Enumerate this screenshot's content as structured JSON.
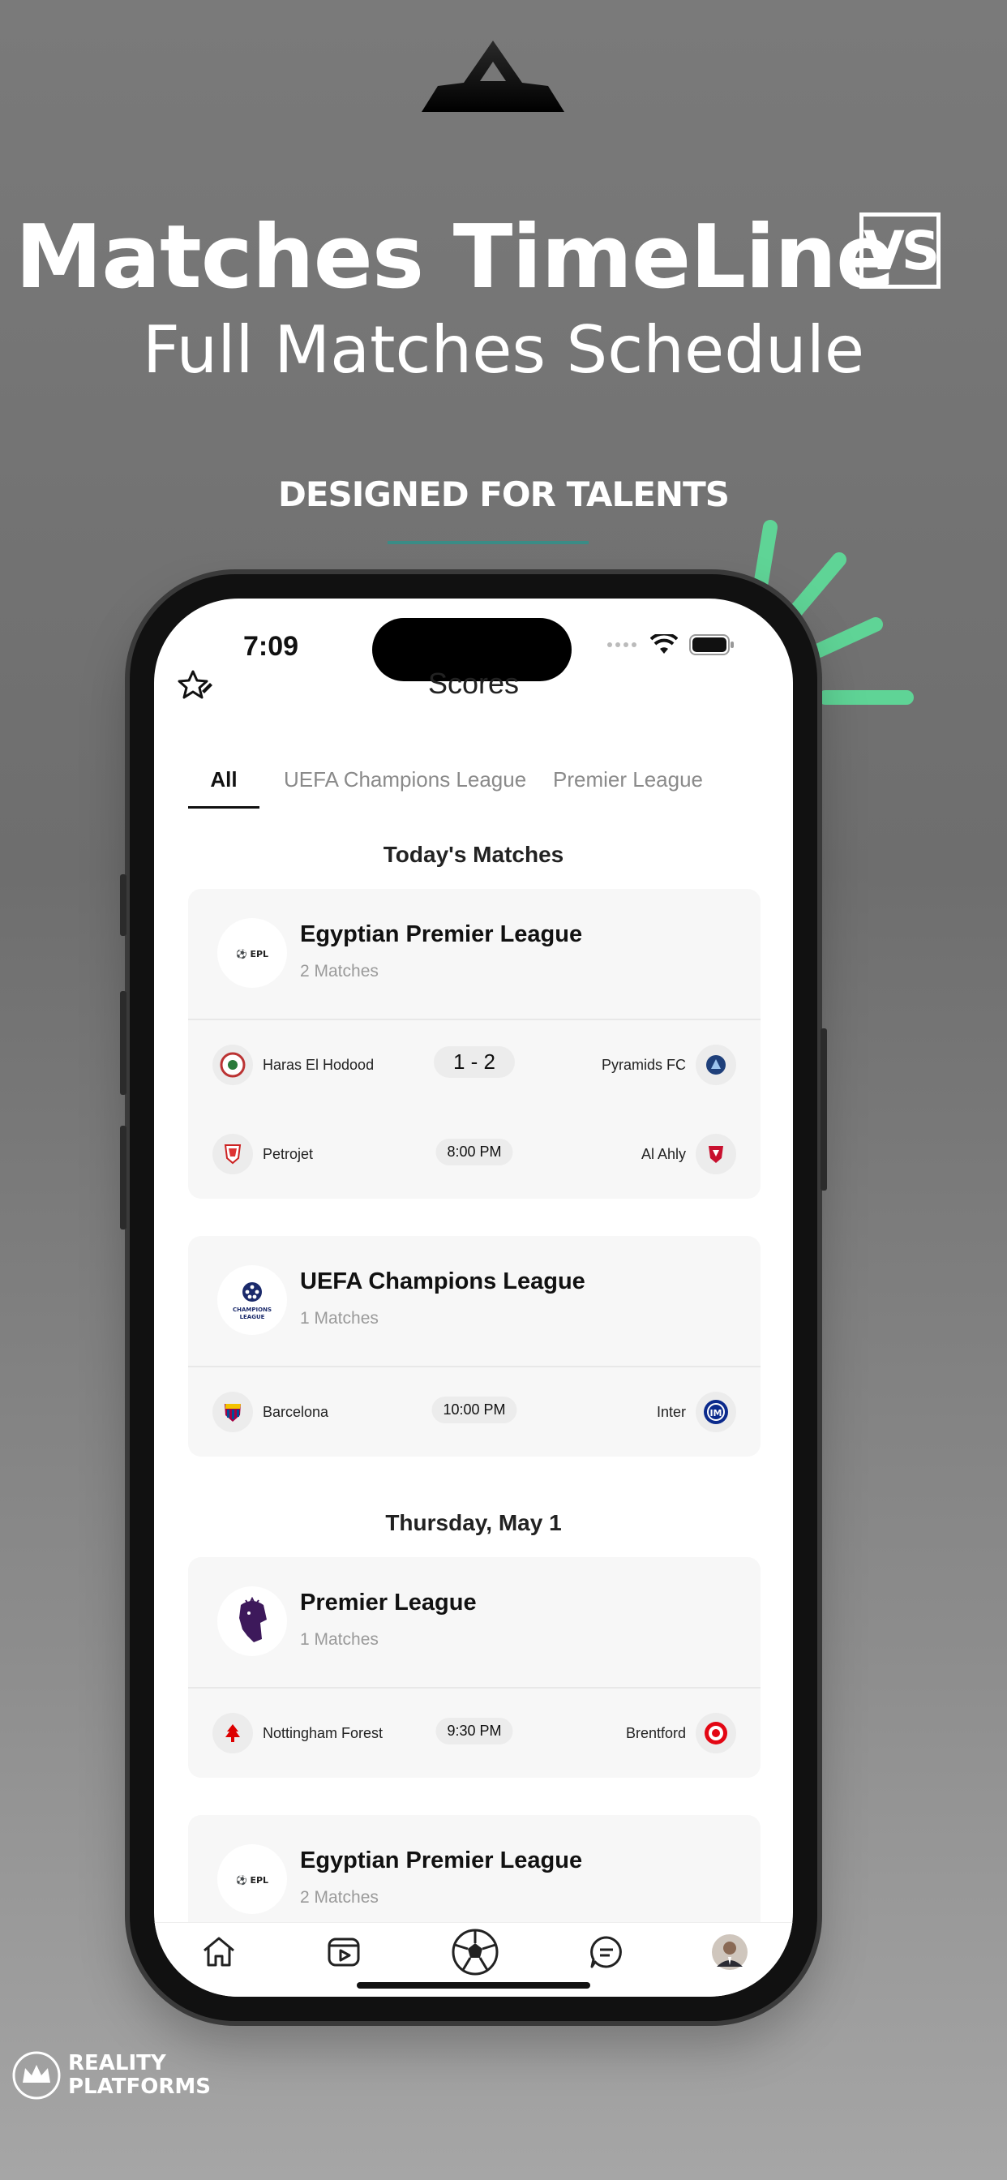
{
  "hero": {
    "title": "Matches TimeLine",
    "vs_badge": "VS",
    "subtitle": "Full Matches Schedule",
    "tagline": "DESIGNED FOR TALENTS"
  },
  "status_bar": {
    "time": "7:09"
  },
  "nav": {
    "title": "Scores"
  },
  "tabs": [
    {
      "label": "All",
      "active": true
    },
    {
      "label": "UEFA Champions League",
      "active": false
    },
    {
      "label": "Premier League",
      "active": false
    }
  ],
  "sections": [
    {
      "title": "Today's Matches",
      "leagues": [
        {
          "name": "Egyptian Premier League",
          "count": "2 Matches",
          "logo_icon": "egyptian-league-logo",
          "matches": [
            {
              "home": "Haras El Hodood",
              "away": "Pyramids FC",
              "center": "1 - 2",
              "home_icon": "haras-el-hodood-crest",
              "away_icon": "pyramids-fc-crest"
            },
            {
              "home": "Petrojet",
              "away": "Al Ahly",
              "center": "8:00 PM",
              "home_icon": "petrojet-crest",
              "away_icon": "al-ahly-crest"
            }
          ]
        },
        {
          "name": "UEFA Champions League",
          "count": "1 Matches",
          "logo_icon": "champions-league-logo",
          "matches": [
            {
              "home": "Barcelona",
              "away": "Inter",
              "center": "10:00 PM",
              "home_icon": "barcelona-crest",
              "away_icon": "inter-crest"
            }
          ]
        }
      ]
    },
    {
      "title": "Thursday, May 1",
      "leagues": [
        {
          "name": "Premier League",
          "count": "1 Matches",
          "logo_icon": "premier-league-logo",
          "matches": [
            {
              "home": "Nottingham Forest",
              "away": "Brentford",
              "center": "9:30 PM",
              "home_icon": "nottingham-forest-crest",
              "away_icon": "brentford-crest"
            }
          ]
        },
        {
          "name": "Egyptian Premier League",
          "count": "2 Matches",
          "logo_icon": "egyptian-league-logo",
          "matches": []
        }
      ]
    }
  ],
  "bottom_tabs": [
    "home-icon",
    "video-icon",
    "football-icon",
    "chat-icon",
    "profile-avatar"
  ],
  "brand": {
    "line1": "REALITY",
    "line2": "PLATFORMS"
  },
  "colors": {
    "accent_green": "#5fd496",
    "deco_line": "#3a8c86"
  }
}
